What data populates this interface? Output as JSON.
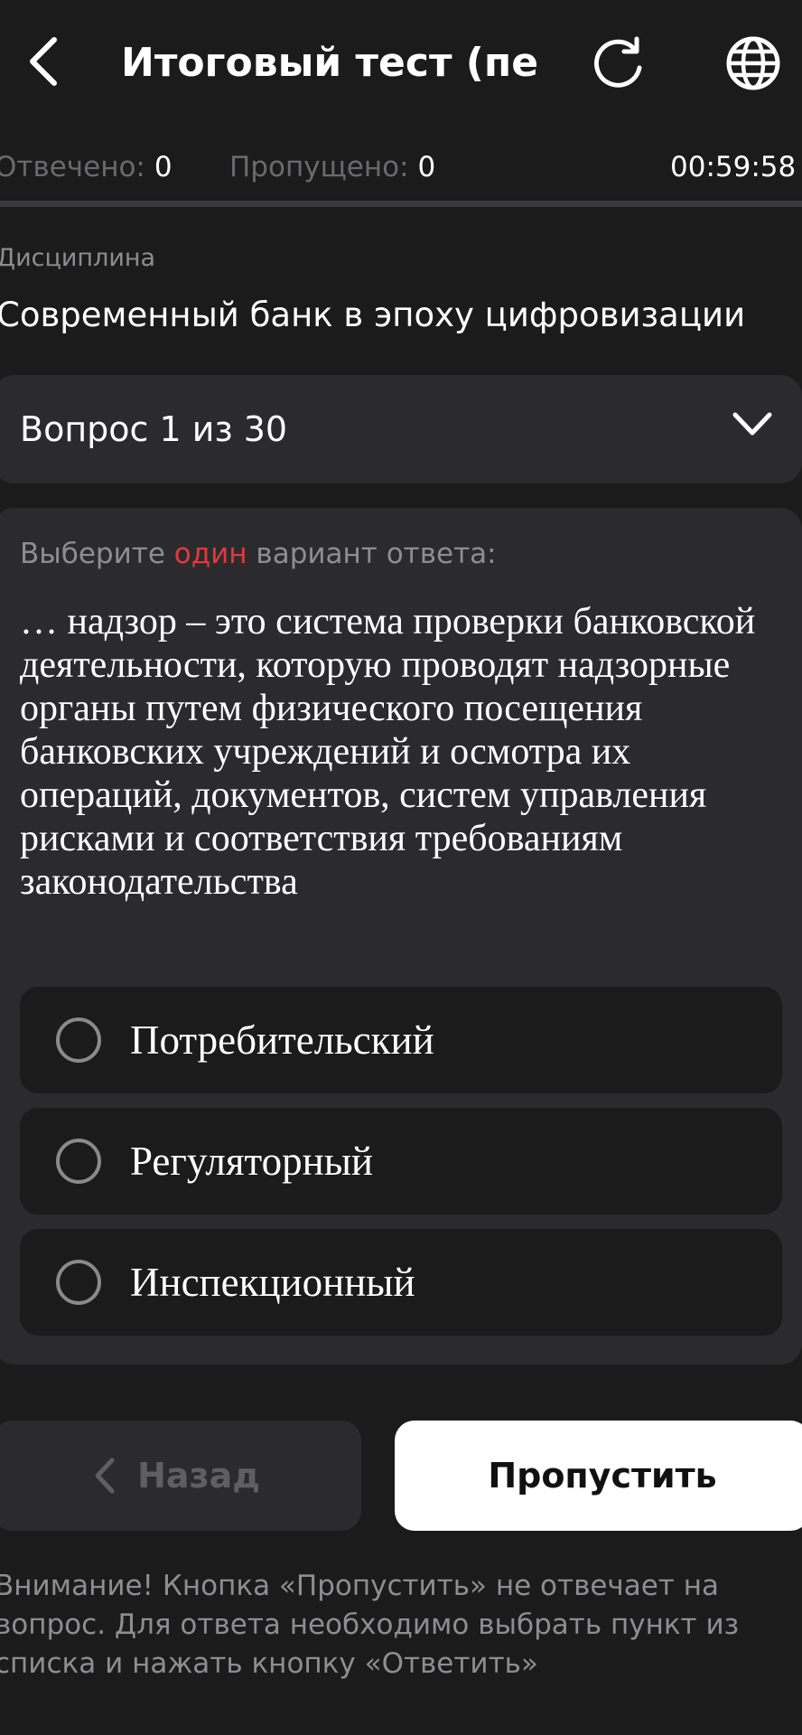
{
  "header": {
    "title": "Итоговый тест (пе...",
    "back_icon": "chevron-left-icon",
    "reload_icon": "reload-icon",
    "language_icon": "globe-icon"
  },
  "stats": {
    "answered_label": "Отвечено:",
    "answered_value": "0",
    "skipped_label": "Пропущено:",
    "skipped_value": "0",
    "timer": "00:59:58"
  },
  "discipline": {
    "label": "Дисциплина",
    "name": "Современный банк в эпоху цифровизации"
  },
  "question_selector": {
    "label": "Вопрос 1 из 30",
    "icon": "chevron-down-icon"
  },
  "question": {
    "instruction_prefix": "Выберите ",
    "instruction_highlight": "один",
    "instruction_suffix": " вариант ответа:",
    "text": "… надзор – это система проверки банковской деятельности, которую проводят надзорные органы путем физического посещения банковских учреждений и осмотра их операций, документов, систем управления рисками и соответствия требованиям законодательства",
    "options": [
      {
        "label": "Потребительский"
      },
      {
        "label": "Регуляторный"
      },
      {
        "label": "Инспекционный"
      }
    ]
  },
  "buttons": {
    "back_label": "Назад",
    "skip_label": "Пропустить"
  },
  "notice": "Внимание! Кнопка «Пропустить» не отвечает на вопрос. Для ответа необходимо выбрать пункт из списка и нажать кнопку «Ответить»",
  "colors": {
    "background": "#1b1b1c",
    "card": "#2b2b2d",
    "accent_red": "#e0393e",
    "muted_text": "#8e8e91"
  }
}
